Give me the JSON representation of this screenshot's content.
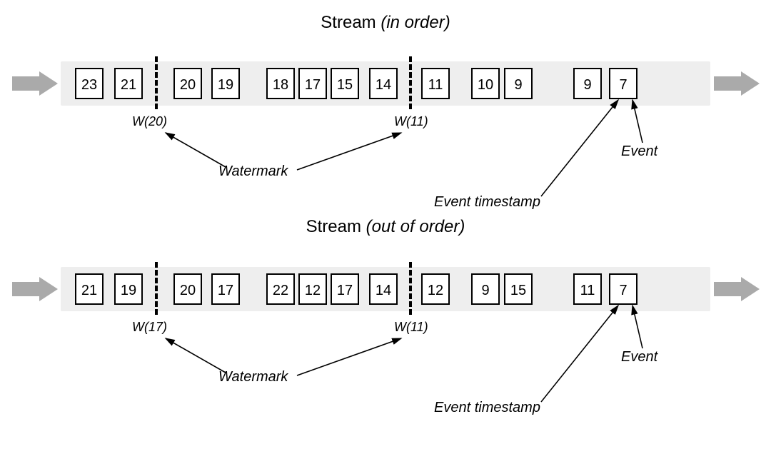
{
  "titles": {
    "top": {
      "prefix": "Stream ",
      "suffix": "(in order)"
    },
    "bottom": {
      "prefix": "Stream ",
      "suffix": "(out of order)"
    }
  },
  "streams": {
    "top": {
      "events": [
        "23",
        "21",
        "20",
        "19",
        "18",
        "17",
        "15",
        "14",
        "11",
        "10",
        "9",
        "9",
        "7"
      ],
      "watermarks": {
        "left": "W(20)",
        "right": "W(11)"
      }
    },
    "bottom": {
      "events": [
        "21",
        "19",
        "20",
        "17",
        "22",
        "12",
        "17",
        "14",
        "12",
        "9",
        "15",
        "11",
        "7"
      ],
      "watermarks": {
        "left": "W(17)",
        "right": "W(11)"
      }
    }
  },
  "labels": {
    "watermark": "Watermark",
    "event": "Event",
    "event_timestamp": "Event timestamp"
  },
  "icons": {
    "flow_arrow": "right-arrow-icon"
  },
  "colors": {
    "arrow_fill": "#aaaaaa",
    "track_bg": "#eeeeee"
  }
}
